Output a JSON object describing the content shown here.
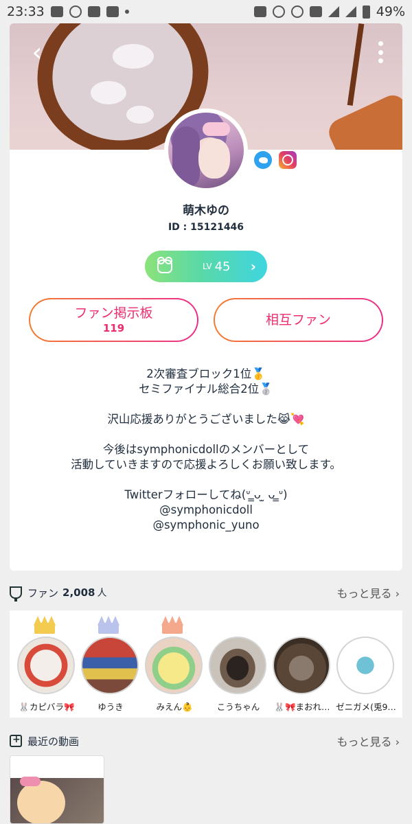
{
  "status_bar": {
    "time": "23:33",
    "battery": "49%"
  },
  "profile": {
    "name": "萌木ゆの",
    "id_text": "ID : 15121446",
    "level_prefix": "LV",
    "level": "45",
    "fan_board_label": "ファン掲示板",
    "fan_board_count": "119",
    "mutual_fan_label": "相互ファン"
  },
  "bio": [
    "2次審査ブロック1位🥇",
    "セミファイナル総合2位🥈",
    "",
    "沢山応援ありがとうございました😹💘",
    "",
    "今後はsymphonicdollのメンバーとして",
    "活動していきますので応援よろしくお願い致します。",
    "",
    "Twitterフォローしてね(ᐡ ̳ᴗ ̫ ᴗ ̳ᐡ)",
    "@symphonicdoll",
    "@symphonic_yuno"
  ],
  "fans_section": {
    "title": "ファン",
    "count": "2,008",
    "unit": "人",
    "more": "もっと見る ›",
    "fans": [
      {
        "name": "🐰カピバラ🎀",
        "crown": "gold"
      },
      {
        "name": "ゆうき",
        "crown": "silver"
      },
      {
        "name": "みえん👶",
        "crown": "bronze"
      },
      {
        "name": "こうちゃん",
        "crown": ""
      },
      {
        "name": "🐰🎀まおれ…",
        "crown": ""
      },
      {
        "name": "ゼニガメ(兎9…",
        "crown": ""
      }
    ]
  },
  "videos_section": {
    "title": "最近の動画",
    "more": "もっと見る ›"
  },
  "colors": {
    "accent_pink": "#ee2d6f",
    "accent_orange": "#f57b2f",
    "level_green": "#8ce27a",
    "level_cyan": "#3fd5e0"
  }
}
